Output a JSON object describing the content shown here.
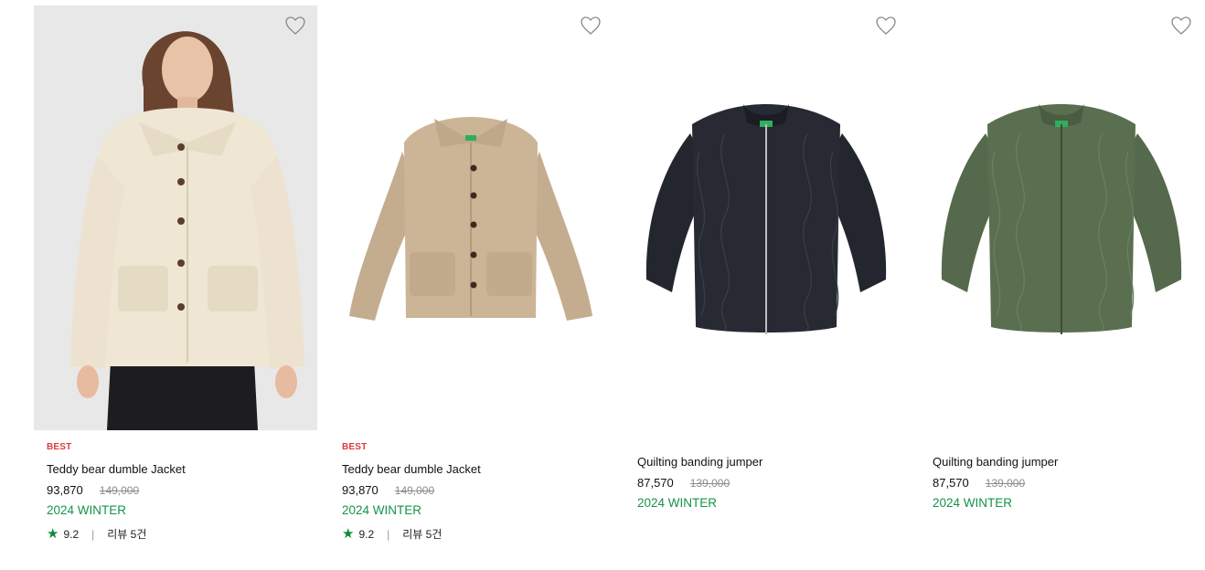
{
  "products": [
    {
      "badge": "BEST",
      "name": "Teddy bear dumble Jacket",
      "price": "93,870",
      "original_price": "149,000",
      "season": "2024 WINTER",
      "rating": "9.2",
      "review_label": "리뷰 5건",
      "separator": "|",
      "wishlist_icon": "heart-outline-icon"
    },
    {
      "badge": "BEST",
      "name": "Teddy bear dumble Jacket",
      "price": "93,870",
      "original_price": "149,000",
      "season": "2024 WINTER",
      "rating": "9.2",
      "review_label": "리뷰 5건",
      "separator": "|",
      "wishlist_icon": "heart-outline-icon"
    },
    {
      "name": "Quilting banding jumper",
      "price": "87,570",
      "original_price": "139,000",
      "season": "2024 WINTER",
      "wishlist_icon": "heart-outline-icon"
    },
    {
      "name": "Quilting banding jumper",
      "price": "87,570",
      "original_price": "139,000",
      "season": "2024 WINTER",
      "wishlist_icon": "heart-outline-icon"
    }
  ],
  "colors": {
    "badge": "#e03a3a",
    "season": "#16934a",
    "star": "#0e8c3a",
    "strike": "#8d8d8d"
  }
}
